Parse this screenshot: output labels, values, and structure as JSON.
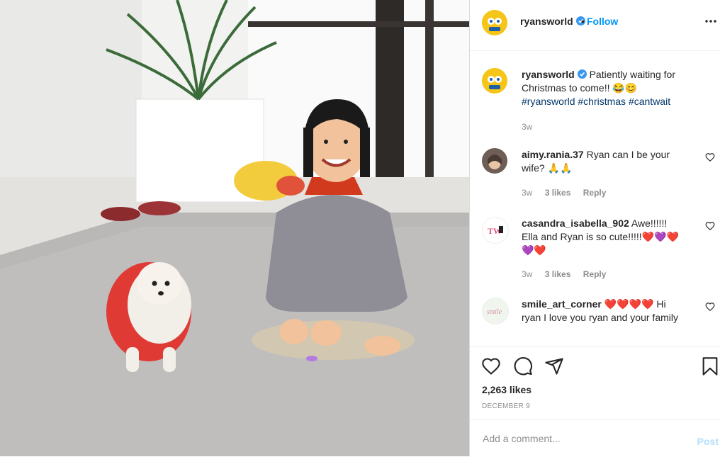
{
  "post": {
    "username": "ryansworld",
    "follow_label": "Follow",
    "separator": "•",
    "caption": "Patiently waiting for Christmas to come!! 😂😊",
    "hashtags": [
      "#ryansworld",
      "#christmas",
      "#cantwait"
    ],
    "caption_time": "3w",
    "likes": "2,263 likes",
    "date": "DECEMBER 9"
  },
  "comments": [
    {
      "user": "aimy.rania.37",
      "text": "Ryan can I be your wife? 🙏🙏",
      "time": "3w",
      "likes": "3 likes",
      "reply": "Reply"
    },
    {
      "user": "casandra_isabella_902",
      "text": "Awe!!!!!! Ella and Ryan is so cute!!!!!❤️💜❤️💜❤️",
      "time": "3w",
      "likes": "3 likes",
      "reply": "Reply"
    },
    {
      "user": "smile_art_corner",
      "text": "❤️❤️❤️❤️ Hi ryan I love you ryan and your family",
      "time": "",
      "likes": "",
      "reply": ""
    }
  ],
  "add_comment": {
    "placeholder": "Add a comment...",
    "post_label": "Post"
  },
  "colors": {
    "link": "#0095f6",
    "hashtag": "#00376b",
    "muted": "#8e8e8e",
    "text": "#262626",
    "avatar_yellow": "#f5c518"
  },
  "icons": [
    "verified-badge-icon",
    "more-options-icon",
    "heart-icon",
    "comment-icon",
    "share-icon",
    "bookmark-icon"
  ]
}
